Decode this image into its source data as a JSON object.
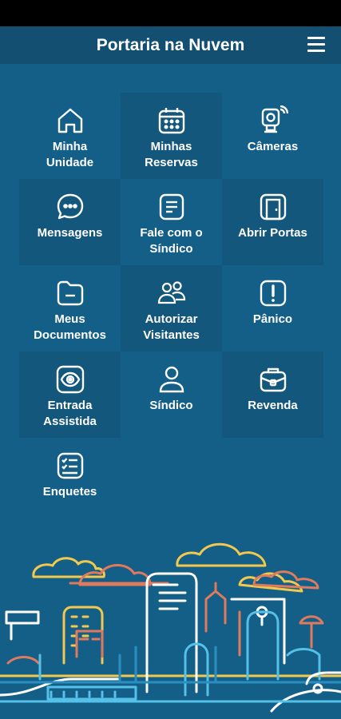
{
  "header": {
    "title": "Portaria na Nuvem",
    "menu_icon": "hamburger-menu-icon"
  },
  "colors": {
    "background": "#145f87",
    "header": "#124f70",
    "tile_dark": "#13577c"
  },
  "menu": [
    {
      "label": "Minha\nUnidade",
      "icon": "home-icon"
    },
    {
      "label": "Minhas\nReservas",
      "icon": "calendar-icon"
    },
    {
      "label": "Câmeras",
      "icon": "camera-icon"
    },
    {
      "label": "Mensagens",
      "icon": "chat-bubble-icon"
    },
    {
      "label": "Fale com o\nSíndico",
      "icon": "document-text-icon"
    },
    {
      "label": "Abrir Portas",
      "icon": "door-icon"
    },
    {
      "label": "Meus\nDocumentos",
      "icon": "folder-icon"
    },
    {
      "label": "Autorizar\nVisitantes",
      "icon": "users-icon"
    },
    {
      "label": "Pânico",
      "icon": "alert-icon"
    },
    {
      "label": "Entrada\nAssistida",
      "icon": "eye-scan-icon"
    },
    {
      "label": "Síndico",
      "icon": "user-icon"
    },
    {
      "label": "Revenda",
      "icon": "briefcase-icon"
    },
    {
      "label": "Enquetes",
      "icon": "checklist-icon"
    }
  ]
}
